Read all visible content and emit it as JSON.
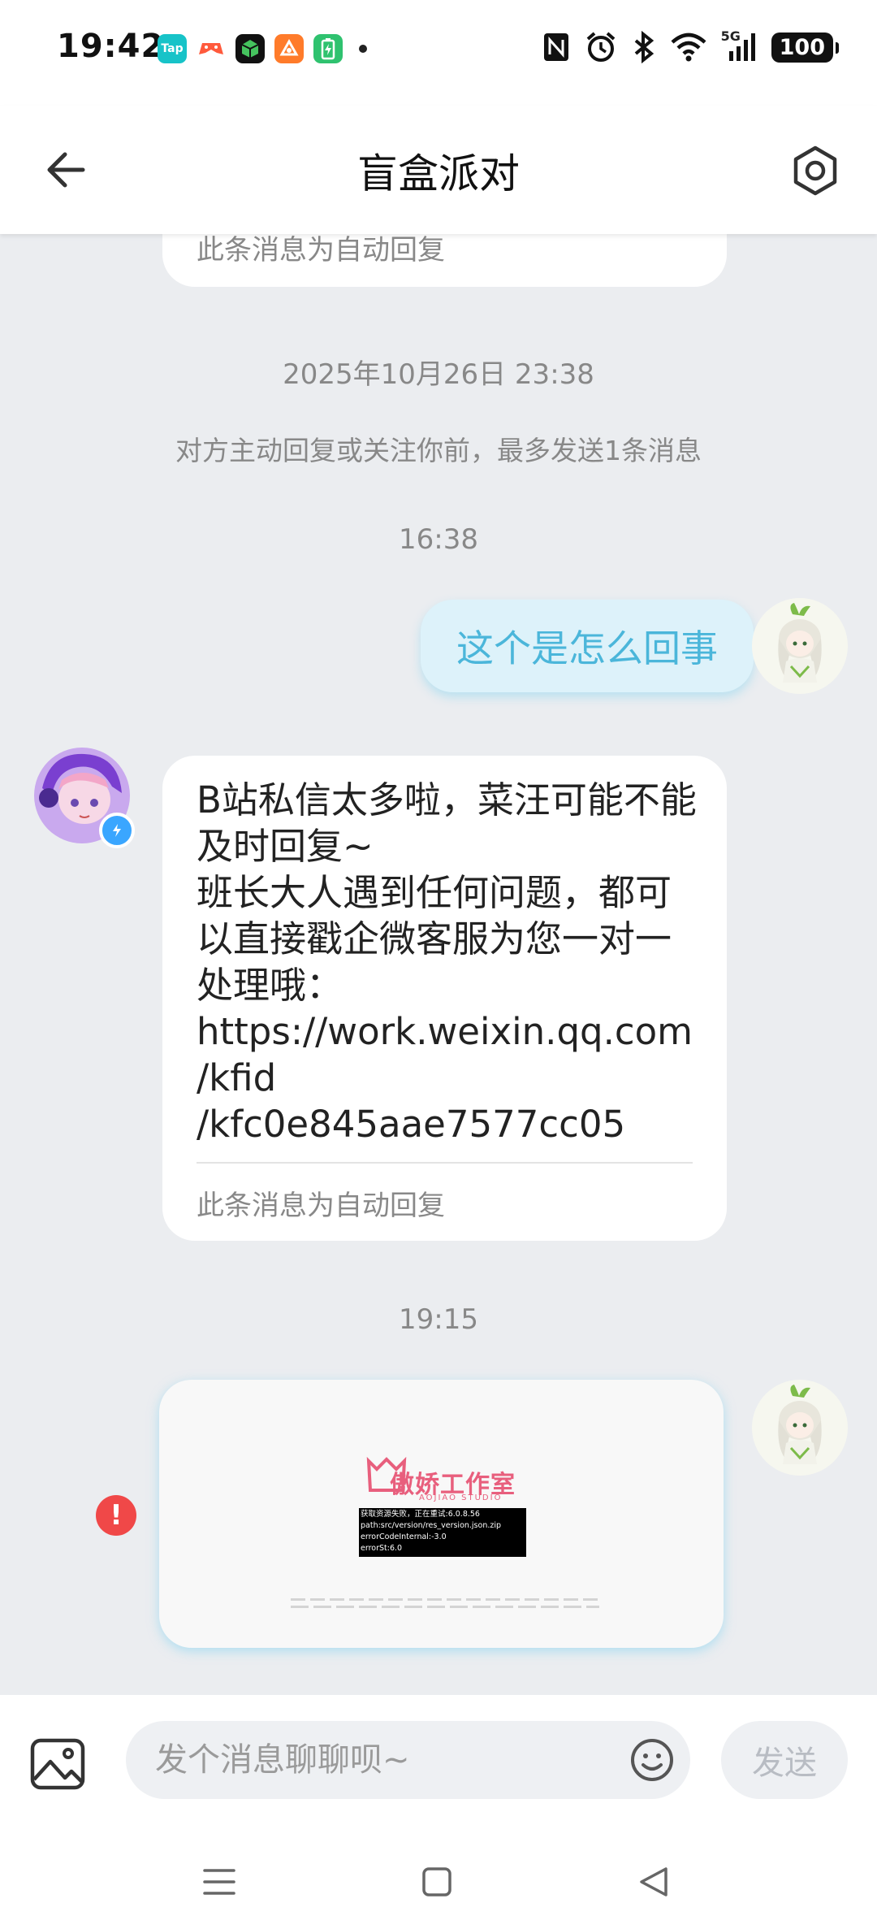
{
  "status_bar": {
    "time": "19:42",
    "app_icons": [
      {
        "name": "taptap-icon",
        "text": "Tap",
        "color": "#17c3c8"
      },
      {
        "name": "game-controller-icon",
        "text": "",
        "color": "#ff6a3d"
      },
      {
        "name": "cube-app-icon",
        "text": "",
        "color": "#2f9b4a"
      },
      {
        "name": "orange-app-icon",
        "text": "",
        "color": "#ff7b2a"
      },
      {
        "name": "battery-saver-icon",
        "text": "",
        "color": "#2fc26f"
      }
    ],
    "network": "5G",
    "battery": "100"
  },
  "header": {
    "title": "盲盒派对"
  },
  "chat": {
    "top_bubble_note": "此条消息为自动回复",
    "timestamp_1": "2025年10月26日 23:38",
    "notice": "对方主动回复或关注你前，最多发送1条消息",
    "timestamp_2": "16:38",
    "my_message": "这个是怎么回事",
    "reply_text": "B站私信太多啦，菜汪可能不能及时回复~\n班长大人遇到任何问题，都可以直接戳企微客服为您一对一处理哦：\nhttps://work.weixin.qq.com\n/kfid\n/kfc0e845aae7577cc05",
    "reply_note": "此条消息为自动回复",
    "timestamp_3": "19:15",
    "image_message": {
      "logo_text": "傲娇工作室",
      "logo_sub": "AOJIAO STUDIO",
      "error_lines": [
        "获取资源失败，正在重试:6.0.8.56",
        "path:src/version/res_version.json.zip",
        "errorCodeInternal:-3.0",
        "errorSt:6.0"
      ]
    },
    "send_failed_symbol": "!"
  },
  "input_bar": {
    "placeholder": "发个消息聊聊呗~",
    "send_label": "发送"
  },
  "colors": {
    "accent": "#4bb6da",
    "my_bubble": "#ddf2fa",
    "error": "#f04848"
  }
}
